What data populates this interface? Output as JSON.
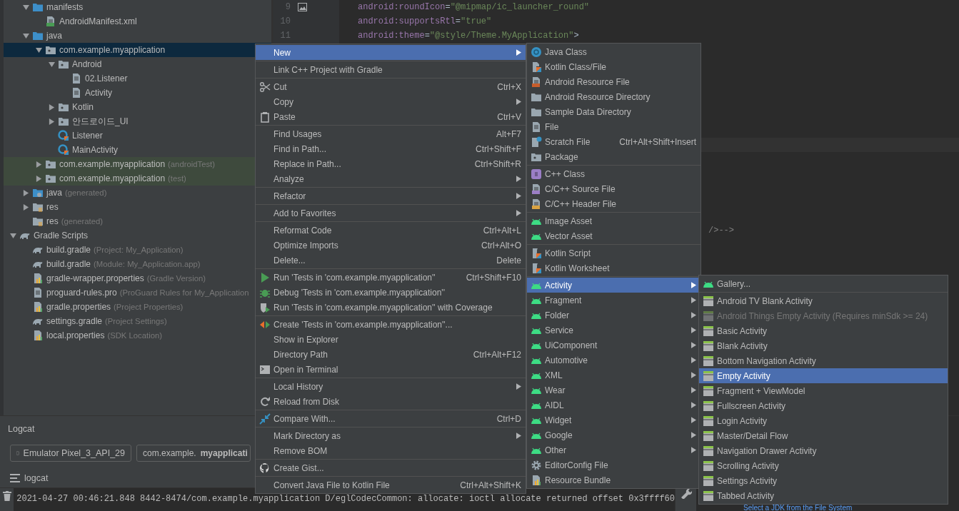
{
  "tree": {
    "module_contents": [
      {
        "label": "manifests",
        "kind": "source-folder",
        "expanded": true,
        "selected": false,
        "children": [
          {
            "label": "AndroidManifest.xml",
            "kind": "manifest",
            "selected": false
          }
        ]
      },
      {
        "label": "java",
        "kind": "source-folder",
        "expanded": true,
        "selected": false,
        "children": [
          {
            "label": "com.example.myapplication",
            "kind": "package",
            "expanded": true,
            "selected": true,
            "children": [
              {
                "label": "Android",
                "kind": "package",
                "expanded": true,
                "selected": false,
                "children": [
                  {
                    "label": "02.Listener",
                    "kind": "file",
                    "selected": false
                  },
                  {
                    "label": "Activity",
                    "kind": "file",
                    "selected": false
                  }
                ]
              },
              {
                "label": "Kotlin",
                "kind": "package",
                "expanded": false,
                "selected": false
              },
              {
                "label": "안드로이드_UI",
                "kind": "package",
                "expanded": false,
                "selected": false
              },
              {
                "label": "Listener",
                "kind": "class",
                "selected": false
              },
              {
                "label": "MainActivity",
                "kind": "class",
                "selected": false
              }
            ]
          },
          {
            "label": "com.example.myapplication",
            "hint": "(androidTest)",
            "kind": "test-package",
            "expanded": false,
            "selected": false
          },
          {
            "label": "com.example.myapplication",
            "hint": "(test)",
            "kind": "test-package",
            "expanded": false,
            "selected": false
          }
        ]
      },
      {
        "label": "java",
        "hint": "(generated)",
        "kind": "generated-folder",
        "expanded": false,
        "selected": false
      },
      {
        "label": "res",
        "kind": "res-folder",
        "expanded": false,
        "selected": false
      },
      {
        "label": "res",
        "hint": "(generated)",
        "kind": "res-folder",
        "selected": false
      }
    ],
    "roots": [
      {
        "label": "Gradle Scripts",
        "kind": "gradle",
        "expanded": true,
        "selected": false,
        "children": [
          {
            "label": "build.gradle",
            "hint": "(Project: My_Application)",
            "kind": "gradle",
            "selected": false
          },
          {
            "label": "build.gradle",
            "hint": "(Module: My_Application.app)",
            "kind": "gradle",
            "selected": false
          },
          {
            "label": "gradle-wrapper.properties",
            "hint": "(Gradle Version)",
            "kind": "properties",
            "selected": false
          },
          {
            "label": "proguard-rules.pro",
            "hint": "(ProGuard Rules for My_Application",
            "kind": "file",
            "selected": false
          },
          {
            "label": "gradle.properties",
            "hint": "(Project Properties)",
            "kind": "properties",
            "selected": false
          },
          {
            "label": "settings.gradle",
            "hint": "(Project Settings)",
            "kind": "gradle",
            "selected": false
          },
          {
            "label": "local.properties",
            "hint": "(SDK Location)",
            "kind": "properties",
            "selected": false
          }
        ]
      }
    ]
  },
  "editor": {
    "lines": [
      {
        "number": "9",
        "tokens": [
          {
            "kind": "attr",
            "text": "android:roundIcon"
          },
          {
            "kind": "punct",
            "text": "="
          },
          {
            "kind": "string",
            "text": "\"@mipmap/ic_launcher_round\""
          }
        ]
      },
      {
        "number": "10",
        "tokens": [
          {
            "kind": "attr",
            "text": "android:supportsRtl"
          },
          {
            "kind": "punct",
            "text": "="
          },
          {
            "kind": "string",
            "text": "\"true\""
          }
        ]
      },
      {
        "number": "11",
        "tokens": [
          {
            "kind": "attr",
            "text": "android:theme"
          },
          {
            "kind": "punct",
            "text": "="
          },
          {
            "kind": "string",
            "text": "\"@style/Theme.MyApplication\""
          },
          {
            "kind": "punct",
            "text": ">"
          }
        ]
      }
    ],
    "fragment": "/>-->"
  },
  "logcat": {
    "title": "Logcat",
    "device": "Emulator Pixel_3_API_29",
    "process": "com.example.**myapplicati**",
    "tab": "logcat",
    "lines": [
      "2021-04-27 00:46:21.848 8442-8474/com.example.myapplication D/eglCodecCommon: allocate: ioctl allocate returned offset 0x3ffff60"
    ]
  },
  "side_panel": {
    "link": "Select a JDK from the File System"
  },
  "context_menu": {
    "groups": [
      {
        "items": [
          {
            "label": "New",
            "kind": "plain",
            "submenu": true,
            "selected": true
          }
        ]
      },
      {
        "items": [
          {
            "label": "Link C++ Project with Gradle",
            "kind": "plain",
            "submenu": false,
            "selected": false
          }
        ]
      },
      {
        "items": [
          {
            "label": "Cut",
            "kind": "cut",
            "shortcut": "Ctrl+X",
            "submenu": false,
            "selected": false
          },
          {
            "label": "Copy",
            "kind": "plain",
            "submenu": true,
            "selected": false
          },
          {
            "label": "Paste",
            "kind": "paste",
            "shortcut": "Ctrl+V",
            "submenu": false,
            "selected": false
          }
        ]
      },
      {
        "items": [
          {
            "label": "Find Usages",
            "kind": "plain",
            "shortcut": "Alt+F7",
            "submenu": false,
            "selected": false
          },
          {
            "label": "Find in Path...",
            "kind": "plain",
            "shortcut": "Ctrl+Shift+F",
            "submenu": false,
            "selected": false
          },
          {
            "label": "Replace in Path...",
            "kind": "plain",
            "shortcut": "Ctrl+Shift+R",
            "submenu": false,
            "selected": false
          },
          {
            "label": "Analyze",
            "kind": "plain",
            "submenu": true,
            "selected": false
          }
        ]
      },
      {
        "items": [
          {
            "label": "Refactor",
            "kind": "plain",
            "submenu": true,
            "selected": false
          }
        ]
      },
      {
        "items": [
          {
            "label": "Add to Favorites",
            "kind": "plain",
            "submenu": true,
            "selected": false
          }
        ]
      },
      {
        "items": [
          {
            "label": "Reformat Code",
            "kind": "plain",
            "shortcut": "Ctrl+Alt+L",
            "submenu": false,
            "selected": false
          },
          {
            "label": "Optimize Imports",
            "kind": "plain",
            "shortcut": "Ctrl+Alt+O",
            "submenu": false,
            "selected": false
          },
          {
            "label": "Delete...",
            "kind": "plain",
            "shortcut": "Delete",
            "submenu": false,
            "selected": false
          }
        ]
      },
      {
        "items": [
          {
            "label": "Run 'Tests in 'com.example.myapplication''",
            "kind": "run",
            "shortcut": "Ctrl+Shift+F10",
            "submenu": false,
            "selected": false
          },
          {
            "label": "Debug 'Tests in 'com.example.myapplication''",
            "kind": "debug",
            "submenu": false,
            "selected": false
          },
          {
            "label": "Run 'Tests in 'com.example.myapplication'' with Coverage",
            "kind": "coverage",
            "submenu": false,
            "selected": false
          }
        ]
      },
      {
        "items": [
          {
            "label": "Create 'Tests in 'com.example.myapplication''...",
            "kind": "create-test",
            "submenu": false,
            "selected": false
          },
          {
            "label": "Show in Explorer",
            "kind": "plain",
            "submenu": false,
            "selected": false
          },
          {
            "label": "Directory Path",
            "kind": "plain",
            "shortcut": "Ctrl+Alt+F12",
            "submenu": false,
            "selected": false
          },
          {
            "label": "Open in Terminal",
            "kind": "terminal",
            "submenu": false,
            "selected": false
          }
        ]
      },
      {
        "items": [
          {
            "label": "Local History",
            "kind": "plain",
            "submenu": true,
            "selected": false
          },
          {
            "label": "Reload from Disk",
            "kind": "reload",
            "submenu": false,
            "selected": false
          }
        ]
      },
      {
        "items": [
          {
            "label": "Compare With...",
            "kind": "compare",
            "shortcut": "Ctrl+D",
            "submenu": false,
            "selected": false
          }
        ]
      },
      {
        "items": [
          {
            "label": "Mark Directory as",
            "kind": "plain",
            "submenu": true,
            "selected": false
          },
          {
            "label": "Remove BOM",
            "kind": "plain",
            "submenu": false,
            "selected": false
          }
        ]
      },
      {
        "items": [
          {
            "label": "Create Gist...",
            "kind": "github",
            "submenu": false,
            "selected": false
          }
        ]
      },
      {
        "items": [
          {
            "label": "Convert Java File to Kotlin File",
            "kind": "plain",
            "shortcut": "Ctrl+Alt+Shift+K",
            "submenu": false,
            "selected": false
          }
        ]
      }
    ]
  },
  "new_menu": {
    "groups": [
      {
        "items": [
          {
            "label": "Java Class",
            "kind": "java-class",
            "submenu": false,
            "selected": false
          },
          {
            "label": "Kotlin Class/File",
            "kind": "kotlin-file",
            "submenu": false,
            "selected": false
          },
          {
            "label": "Android Resource File",
            "kind": "resource-file",
            "submenu": false,
            "selected": false
          },
          {
            "label": "Android Resource Directory",
            "kind": "folder",
            "submenu": false,
            "selected": false
          },
          {
            "label": "Sample Data Directory",
            "kind": "folder",
            "submenu": false,
            "selected": false
          },
          {
            "label": "File",
            "kind": "file",
            "submenu": false,
            "selected": false
          },
          {
            "label": "Scratch File",
            "kind": "scratch",
            "shortcut": "Ctrl+Alt+Shift+Insert",
            "submenu": false,
            "selected": false
          },
          {
            "label": "Package",
            "kind": "package",
            "submenu": false,
            "selected": false
          }
        ]
      },
      {
        "items": [
          {
            "label": "C++ Class",
            "kind": "cpp-class",
            "submenu": false,
            "selected": false
          },
          {
            "label": "C/C++ Source File",
            "kind": "cpp-source",
            "submenu": false,
            "selected": false
          },
          {
            "label": "C/C++ Header File",
            "kind": "cpp-header",
            "submenu": false,
            "selected": false
          }
        ]
      },
      {
        "items": [
          {
            "label": "Image Asset",
            "kind": "android",
            "submenu": false,
            "selected": false
          },
          {
            "label": "Vector Asset",
            "kind": "android",
            "submenu": false,
            "selected": false
          }
        ]
      },
      {
        "items": [
          {
            "label": "Kotlin Script",
            "kind": "kotlin-script",
            "submenu": false,
            "selected": false
          },
          {
            "label": "Kotlin Worksheet",
            "kind": "kotlin-script",
            "submenu": false,
            "selected": false
          }
        ]
      },
      {
        "items": [
          {
            "label": "Activity",
            "kind": "android",
            "submenu": true,
            "selected": true
          },
          {
            "label": "Fragment",
            "kind": "android",
            "submenu": true,
            "selected": false
          },
          {
            "label": "Folder",
            "kind": "android",
            "submenu": true,
            "selected": false
          },
          {
            "label": "Service",
            "kind": "android",
            "submenu": true,
            "selected": false
          },
          {
            "label": "UiComponent",
            "kind": "android",
            "submenu": true,
            "selected": false
          },
          {
            "label": "Automotive",
            "kind": "android",
            "submenu": true,
            "selected": false
          },
          {
            "label": "XML",
            "kind": "android",
            "submenu": true,
            "selected": false
          },
          {
            "label": "Wear",
            "kind": "android",
            "submenu": true,
            "selected": false
          },
          {
            "label": "AIDL",
            "kind": "android",
            "submenu": true,
            "selected": false
          },
          {
            "label": "Widget",
            "kind": "android",
            "submenu": true,
            "selected": false
          },
          {
            "label": "Google",
            "kind": "android",
            "submenu": true,
            "selected": false
          },
          {
            "label": "Other",
            "kind": "android",
            "submenu": true,
            "selected": false
          },
          {
            "label": "EditorConfig File",
            "kind": "gear",
            "submenu": false,
            "selected": false
          },
          {
            "label": "Resource Bundle",
            "kind": "properties",
            "submenu": false,
            "selected": false
          }
        ]
      }
    ]
  },
  "activity_menu": {
    "groups": [
      {
        "items": [
          {
            "label": "Gallery...",
            "kind": "android",
            "submenu": false,
            "selected": false,
            "disabled": false
          }
        ]
      },
      {
        "items": [
          {
            "label": "Android TV Blank Activity",
            "kind": "template",
            "submenu": false,
            "selected": false,
            "disabled": false
          },
          {
            "label": "Android Things Empty Activity (Requires minSdk >= 24)",
            "kind": "template",
            "submenu": false,
            "selected": false,
            "disabled": true
          },
          {
            "label": "Basic Activity",
            "kind": "template",
            "submenu": false,
            "selected": false,
            "disabled": false
          },
          {
            "label": "Blank Activity",
            "kind": "template",
            "submenu": false,
            "selected": false,
            "disabled": false
          },
          {
            "label": "Bottom Navigation Activity",
            "kind": "template",
            "submenu": false,
            "selected": false,
            "disabled": false
          },
          {
            "label": "Empty Activity",
            "kind": "template",
            "submenu": false,
            "selected": true,
            "disabled": false
          },
          {
            "label": "Fragment + ViewModel",
            "kind": "template",
            "submenu": false,
            "selected": false,
            "disabled": false
          },
          {
            "label": "Fullscreen Activity",
            "kind": "template",
            "submenu": false,
            "selected": false,
            "disabled": false
          },
          {
            "label": "Login Activity",
            "kind": "template",
            "submenu": false,
            "selected": false,
            "disabled": false
          },
          {
            "label": "Master/Detail Flow",
            "kind": "template",
            "submenu": false,
            "selected": false,
            "disabled": false
          },
          {
            "label": "Navigation Drawer Activity",
            "kind": "template",
            "submenu": false,
            "selected": false,
            "disabled": false
          },
          {
            "label": "Scrolling Activity",
            "kind": "template",
            "submenu": false,
            "selected": false,
            "disabled": false
          },
          {
            "label": "Settings Activity",
            "kind": "template",
            "submenu": false,
            "selected": false,
            "disabled": false
          },
          {
            "label": "Tabbed Activity",
            "kind": "template",
            "submenu": false,
            "selected": false,
            "disabled": false
          }
        ]
      }
    ]
  }
}
